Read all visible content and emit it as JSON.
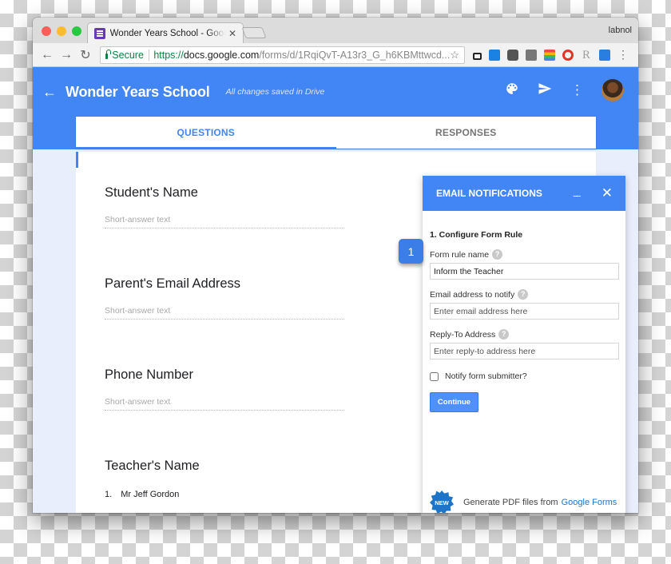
{
  "browser": {
    "tab_title": "Wonder Years School - Google Forms",
    "tab_close": "✕",
    "profile_name": "labnol",
    "nav": {
      "back": "←",
      "forward": "→",
      "reload": "C"
    },
    "omnibox": {
      "secure_label": "Secure",
      "url_scheme": "https://",
      "url_host": "docs.google.com",
      "url_path": "/forms/d/1RqiQvT-A13r3_G_h6KBMttwcd..."
    },
    "bookmark_star": "☆",
    "menu_glyph": "⋮",
    "extensions": [
      {
        "name": "lock-extension-icon",
        "color": "#222222"
      },
      {
        "name": "trello-extension-icon",
        "color": "#1a82e2"
      },
      {
        "name": "pocket-extension-icon",
        "color": "#555555"
      },
      {
        "name": "keep-extension-icon",
        "color": "#777777"
      },
      {
        "name": "colorful-extension-icon",
        "color": "#e84c3d"
      },
      {
        "name": "red-circle-extension-icon",
        "color": "#e5332a"
      },
      {
        "name": "r-extension-icon",
        "color": "#9e9e9e"
      },
      {
        "name": "blue-square-extension-icon",
        "color": "#2a7ee0"
      }
    ]
  },
  "forms_header": {
    "back_glyph": "←",
    "title": "Wonder Years School",
    "save_status": "All changes saved in Drive",
    "palette_glyph": "🎨",
    "send_glyph": "➤",
    "more_glyph": "⋮"
  },
  "form_tabs": [
    {
      "label": "QUESTIONS",
      "active": true
    },
    {
      "label": "RESPONSES",
      "active": false
    }
  ],
  "questions": [
    {
      "title": "Student's Name",
      "answer_placeholder": "Short-answer text"
    },
    {
      "title": "Parent's Email Address",
      "answer_placeholder": "Short-answer text"
    },
    {
      "title": "Phone Number",
      "answer_placeholder": "Short-answer text"
    },
    {
      "title": "Teacher's Name",
      "option_number": "1.",
      "option_label": "Mr Jeff Gordon"
    }
  ],
  "step_badge": "1",
  "notifications_panel": {
    "title": "EMAIL NOTIFICATIONS",
    "minimize_glyph": "_",
    "close_glyph": "✕",
    "section_title": "1. Configure Form Rule",
    "help_glyph": "?",
    "fields": {
      "rule_name": {
        "label": "Form rule name",
        "value": "Inform the Teacher"
      },
      "notify_email": {
        "label": "Email address to notify",
        "placeholder": "Enter email address here"
      },
      "reply_to": {
        "label": "Reply-To Address",
        "placeholder": "Enter reply-to address here"
      }
    },
    "notify_submitter": {
      "label": "Notify form submitter?",
      "checked": false
    },
    "continue_label": "Continue",
    "promo": {
      "badge": "NEW",
      "text": "Generate PDF files from",
      "link": "Google Forms"
    }
  },
  "colors": {
    "accent": "#4285f4",
    "secure_green": "#0b8043",
    "forms_purple": "#673ab7"
  }
}
